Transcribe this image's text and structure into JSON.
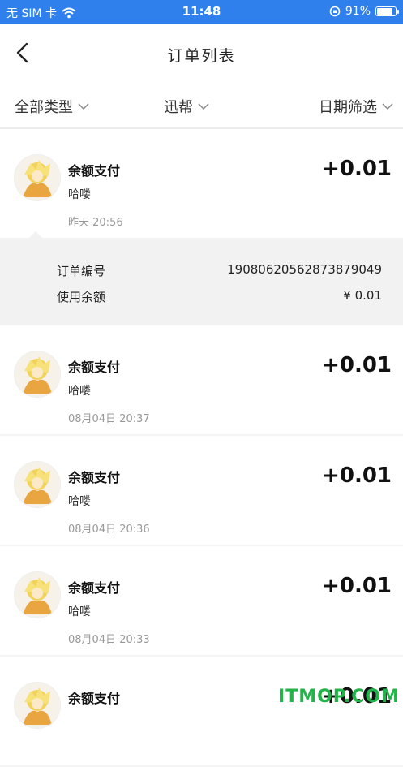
{
  "status_bar": {
    "carrier": "无 SIM 卡",
    "time": "11:48",
    "battery_percent": "91%",
    "battery_level": 0.91,
    "icons": [
      "wifi-icon",
      "orientation-lock-icon",
      "battery-icon"
    ]
  },
  "header": {
    "title": "订单列表"
  },
  "filters": {
    "type": "全部类型",
    "user": "迅帮",
    "date": "日期筛选"
  },
  "orders": [
    {
      "name": "余额支付",
      "sub": "哈喽",
      "time": "昨天 20:56",
      "amount": "+0.01"
    },
    {
      "name": "余额支付",
      "sub": "哈喽",
      "time": "08月04日 20:37",
      "amount": "+0.01"
    },
    {
      "name": "余额支付",
      "sub": "哈喽",
      "time": "08月04日 20:36",
      "amount": "+0.01"
    },
    {
      "name": "余额支付",
      "sub": "哈喽",
      "time": "08月04日 20:33",
      "amount": "+0.01"
    },
    {
      "name": "余额支付",
      "amount": "+0.01"
    }
  ],
  "detail": {
    "order_no_label": "订单编号",
    "order_no": "19080620562873879049",
    "balance_label": "使用余额",
    "balance_value": "¥ 0.01"
  },
  "watermark": "ITMOP.COM",
  "colors": {
    "status_bar": "#2f80ed",
    "detail_bg": "#f2f2f2",
    "watermark": "#24b34a"
  }
}
